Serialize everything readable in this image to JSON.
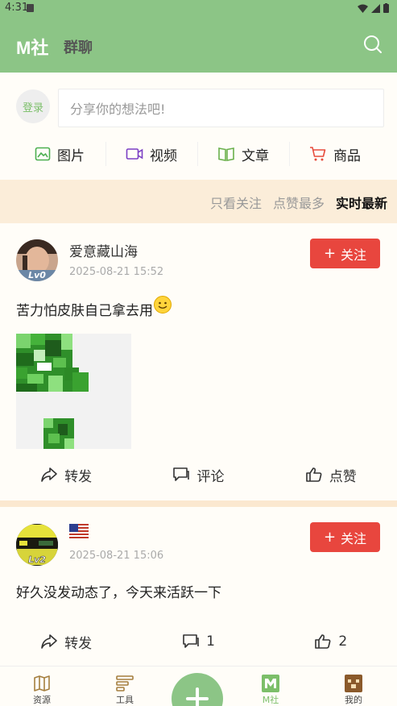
{
  "status": {
    "time": "4:31"
  },
  "header": {
    "logo": "M社",
    "title": "群聊"
  },
  "composer": {
    "login_label": "登录",
    "placeholder": "分享你的想法吧!"
  },
  "post_types": [
    {
      "label": "图片",
      "icon": "image-icon"
    },
    {
      "label": "视频",
      "icon": "video-icon"
    },
    {
      "label": "文章",
      "icon": "book-icon"
    },
    {
      "label": "商品",
      "icon": "cart-icon"
    }
  ],
  "filters": {
    "following": "只看关注",
    "most_liked": "点赞最多",
    "latest": "实时最新",
    "active": "latest"
  },
  "posts": [
    {
      "username": "爱意藏山海",
      "avatar_badge": "Lv0",
      "date": "2025-08-21 15:52",
      "follow_label": "关注",
      "content": "苦力怕皮肤自己拿去用",
      "has_emoji": true,
      "repost_label": "转发",
      "comment_label": "评论",
      "like_label": "点赞"
    },
    {
      "username": "🇺🇸",
      "avatar_badge": "Lv2",
      "date": "2025-08-21 15:06",
      "follow_label": "关注",
      "content": "好久没发动态了，今天来活跃一下",
      "repost_label": "转发",
      "comment_label": "1",
      "like_label": "2"
    }
  ],
  "bottom_nav": [
    {
      "label": "资源",
      "icon": "map-icon"
    },
    {
      "label": "工具",
      "icon": "tools-icon"
    },
    {
      "label": "M社",
      "icon": "m-community-icon",
      "active": true
    },
    {
      "label": "我的",
      "icon": "profile-icon"
    }
  ],
  "colors": {
    "primary": "#8cc586",
    "follow": "#e8463e",
    "filter_bg": "#fbedd9"
  }
}
